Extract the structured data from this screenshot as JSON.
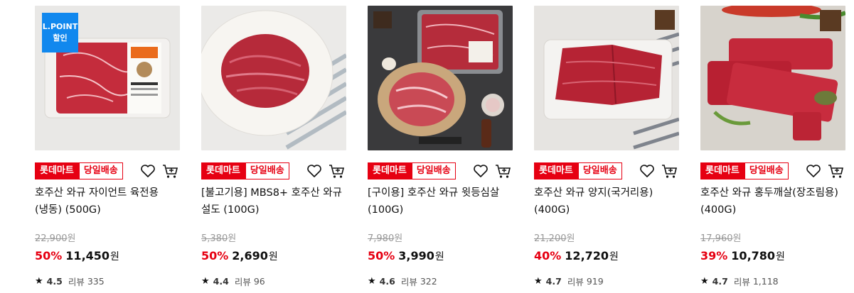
{
  "products": [
    {
      "promo": "L.POINT\n할인",
      "store": "롯데마트",
      "delivery": "당일배송",
      "title": "호주산 와규 자이언트 육전용 (냉동) (500G)",
      "original_price": "22,900",
      "discount": "50%",
      "price": "11,450",
      "currency": "원",
      "rating": "4.5",
      "review_label": "리뷰",
      "reviews": "335"
    },
    {
      "store": "롯데마트",
      "delivery": "당일배송",
      "title": "[불고기용] MBS8+ 호주산 와규 설도 (100G)",
      "original_price": "5,380",
      "discount": "50%",
      "price": "2,690",
      "currency": "원",
      "rating": "4.4",
      "review_label": "리뷰",
      "reviews": "96"
    },
    {
      "store": "롯데마트",
      "delivery": "당일배송",
      "title": "[구이용] 호주산 와규 윗등심살 (100G)",
      "original_price": "7,980",
      "discount": "50%",
      "price": "3,990",
      "currency": "원",
      "rating": "4.6",
      "review_label": "리뷰",
      "reviews": "322"
    },
    {
      "store": "롯데마트",
      "delivery": "당일배송",
      "title": "호주산 와규 양지(국거리용) (400G)",
      "original_price": "21,200",
      "discount": "40%",
      "price": "12,720",
      "currency": "원",
      "rating": "4.7",
      "review_label": "리뷰",
      "reviews": "919"
    },
    {
      "store": "롯데마트",
      "delivery": "당일배송",
      "title": "호주산 와규 홍두깨살(장조림용) (400G)",
      "original_price": "17,960",
      "discount": "39%",
      "price": "10,780",
      "currency": "원",
      "rating": "4.7",
      "review_label": "리뷰",
      "reviews": "1,118"
    }
  ],
  "icons": {
    "wishlist": "heart-icon",
    "cart": "cart-icon",
    "rating": "star-icon"
  },
  "colors": {
    "accent": "#e60012",
    "lpoint": "#1188ee"
  }
}
